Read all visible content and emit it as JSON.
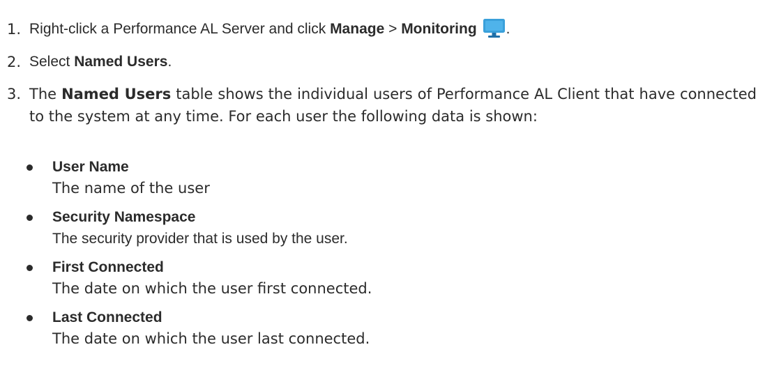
{
  "steps": [
    {
      "number": "1.",
      "text_before": "Right-click a Performance AL Server and click ",
      "bold_1": "Manage",
      "separator": " > ",
      "bold_2": "Monitoring",
      "icon": "monitor-icon",
      "text_after": "."
    },
    {
      "number": "2.",
      "text_before": "Select ",
      "bold_1": "Named Users",
      "text_after": "."
    },
    {
      "number": "3.",
      "text_before": "The ",
      "bold_1": "Named Users",
      "text_after": " table shows the individual users of Performance AL Client that have connected to the system at any time. For each user the following data is shown:"
    }
  ],
  "fields": [
    {
      "title": "User Name",
      "description": "The name of the user"
    },
    {
      "title": "Security Namespace",
      "description": "The security provider that is used by the user."
    },
    {
      "title": "First Connected",
      "description": "The date on which the user first connected."
    },
    {
      "title": "Last Connected",
      "description": "The date on which the user last connected."
    }
  ],
  "colors": {
    "text": "#2b2b2b",
    "icon_fill": "#3aa0da",
    "icon_dark": "#1f6fa8"
  }
}
